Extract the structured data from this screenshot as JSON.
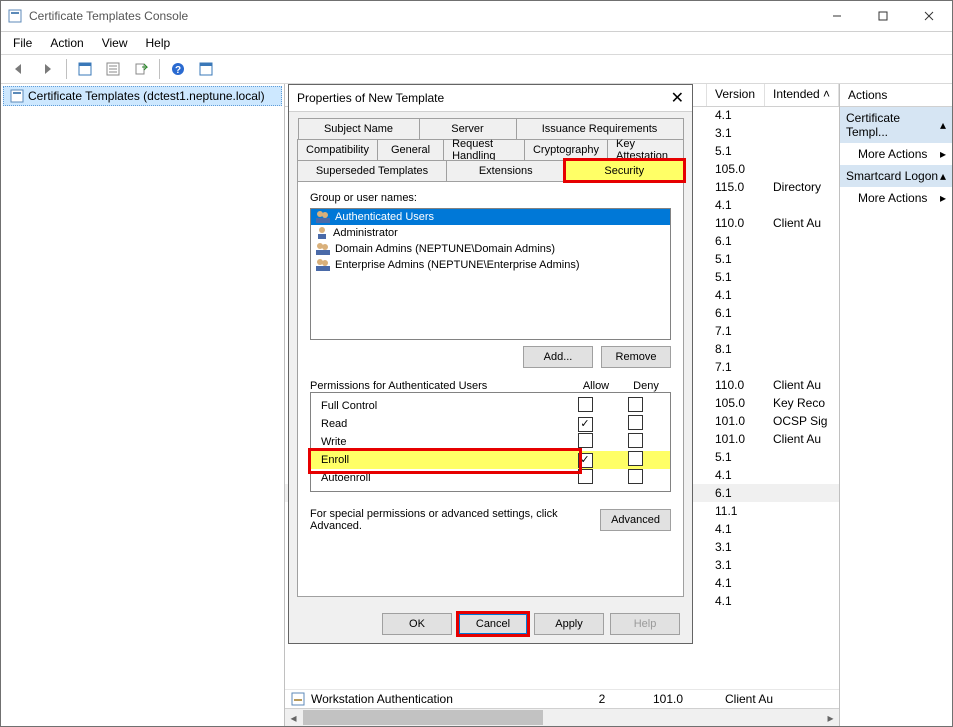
{
  "window": {
    "title": "Certificate Templates Console"
  },
  "menus": [
    "File",
    "Action",
    "View",
    "Help"
  ],
  "tree": {
    "item": "Certificate Templates (dctest1.neptune.local)"
  },
  "list": {
    "headers": {
      "version": "Version",
      "intended": "Intended"
    },
    "rows": [
      {
        "ver": "4.1",
        "int": ""
      },
      {
        "ver": "3.1",
        "int": ""
      },
      {
        "ver": "5.1",
        "int": ""
      },
      {
        "ver": "105.0",
        "int": ""
      },
      {
        "ver": "115.0",
        "int": "Directory"
      },
      {
        "ver": "4.1",
        "int": ""
      },
      {
        "ver": "110.0",
        "int": "Client Au"
      },
      {
        "ver": "6.1",
        "int": ""
      },
      {
        "ver": "5.1",
        "int": ""
      },
      {
        "ver": "5.1",
        "int": ""
      },
      {
        "ver": "4.1",
        "int": ""
      },
      {
        "ver": "6.1",
        "int": ""
      },
      {
        "ver": "7.1",
        "int": ""
      },
      {
        "ver": "8.1",
        "int": ""
      },
      {
        "ver": "7.1",
        "int": ""
      },
      {
        "ver": "110.0",
        "int": "Client Au"
      },
      {
        "ver": "105.0",
        "int": "Key Reco"
      },
      {
        "ver": "101.0",
        "int": "OCSP Sig"
      },
      {
        "ver": "101.0",
        "int": "Client Au"
      },
      {
        "ver": "5.1",
        "int": ""
      },
      {
        "ver": "4.1",
        "int": ""
      },
      {
        "ver": "6.1",
        "int": "",
        "sel": true
      },
      {
        "ver": "11.1",
        "int": ""
      },
      {
        "ver": "4.1",
        "int": ""
      },
      {
        "ver": "3.1",
        "int": ""
      },
      {
        "ver": "3.1",
        "int": ""
      },
      {
        "ver": "4.1",
        "int": ""
      },
      {
        "ver": "4.1",
        "int": ""
      }
    ],
    "bottom": {
      "name": "Workstation Authentication",
      "minver": "2",
      "ver": "101.0",
      "int": "Client Au"
    }
  },
  "actions": {
    "title": "Actions",
    "section1": "Certificate Templ...",
    "more": "More Actions",
    "section2": "Smartcard Logon"
  },
  "dialog": {
    "title": "Properties of New Template",
    "tabs": {
      "r1": [
        "Subject Name",
        "Server",
        "Issuance Requirements"
      ],
      "r2": [
        "Compatibility",
        "General",
        "Request Handling",
        "Cryptography",
        "Key Attestation"
      ],
      "r3": [
        "Superseded Templates",
        "Extensions",
        "Security"
      ]
    },
    "groupLabel": "Group or user names:",
    "groups": [
      {
        "name": "Authenticated Users",
        "sel": true,
        "multi": true
      },
      {
        "name": "Administrator",
        "sel": false,
        "multi": false
      },
      {
        "name": "Domain Admins (NEPTUNE\\Domain Admins)",
        "sel": false,
        "multi": true
      },
      {
        "name": "Enterprise Admins (NEPTUNE\\Enterprise Admins)",
        "sel": false,
        "multi": true
      }
    ],
    "addBtn": "Add...",
    "removeBtn": "Remove",
    "permLabel": "Permissions for Authenticated Users",
    "allow": "Allow",
    "deny": "Deny",
    "perms": [
      {
        "name": "Full Control",
        "allow": false,
        "deny": false,
        "hl": false
      },
      {
        "name": "Read",
        "allow": true,
        "deny": false,
        "hl": false
      },
      {
        "name": "Write",
        "allow": false,
        "deny": false,
        "hl": false
      },
      {
        "name": "Enroll",
        "allow": true,
        "deny": false,
        "hl": true
      },
      {
        "name": "Autoenroll",
        "allow": false,
        "deny": false,
        "hl": false
      }
    ],
    "specialText": "For special permissions or advanced settings, click Advanced.",
    "advancedBtn": "Advanced",
    "ok": "OK",
    "cancel": "Cancel",
    "apply": "Apply",
    "help": "Help"
  }
}
